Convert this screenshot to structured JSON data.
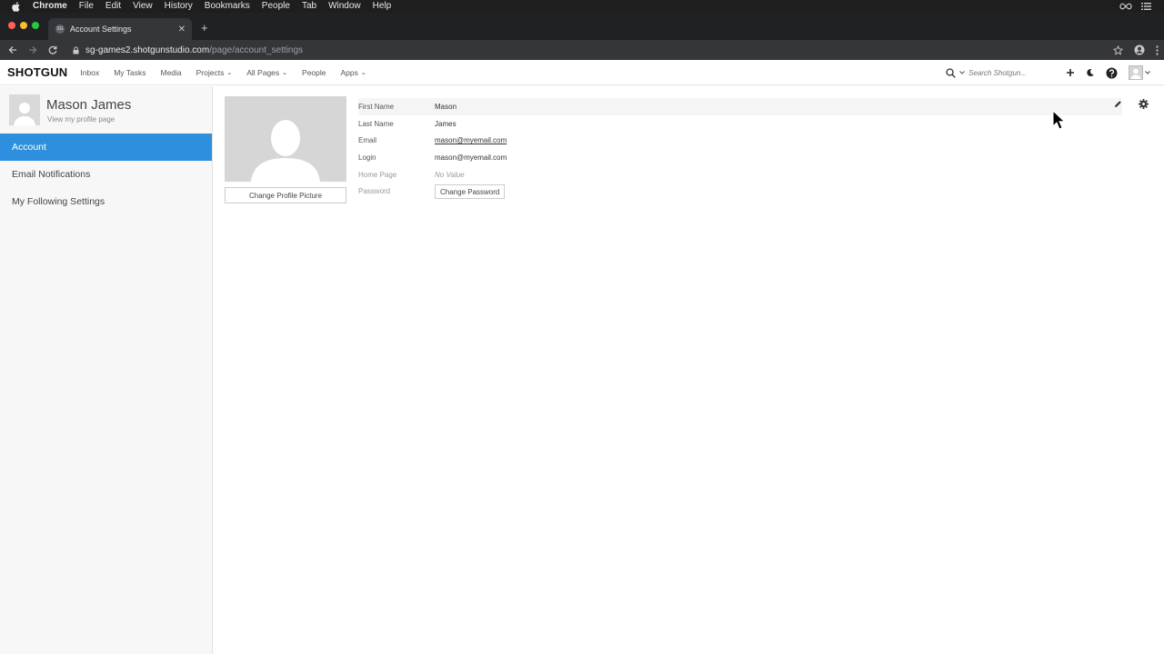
{
  "mac_menu": {
    "items": [
      "Chrome",
      "File",
      "Edit",
      "View",
      "History",
      "Bookmarks",
      "People",
      "Tab",
      "Window",
      "Help"
    ]
  },
  "browser": {
    "tab_title": "Account Settings",
    "favicon_text": "SG",
    "url_host": "sg-games2.shotgunstudio.com",
    "url_path": "/page/account_settings"
  },
  "app_nav": {
    "logo": "SHOTGUN",
    "links": [
      "Inbox",
      "My Tasks",
      "Media",
      "Projects",
      "All Pages",
      "People",
      "Apps"
    ],
    "search_placeholder": "Search Shotgun..."
  },
  "sidebar": {
    "user_name": "Mason James",
    "profile_link": "View my profile page",
    "items": [
      {
        "label": "Account",
        "active": true
      },
      {
        "label": "Email Notifications",
        "active": false
      },
      {
        "label": "My Following Settings",
        "active": false
      }
    ]
  },
  "account": {
    "change_picture_label": "Change Profile Picture",
    "fields": [
      {
        "label": "First Name",
        "value": "Mason"
      },
      {
        "label": "Last Name",
        "value": "James"
      },
      {
        "label": "Email",
        "value": "mason@myemail.com"
      },
      {
        "label": "Login",
        "value": "mason@myemail.com"
      },
      {
        "label": "Home Page",
        "value": "No Value"
      },
      {
        "label": "Password",
        "value": "Change Password"
      }
    ]
  },
  "icons": {
    "edit": "pencil-icon",
    "settings": "gear-icon",
    "accent": "#2d8fdd"
  }
}
